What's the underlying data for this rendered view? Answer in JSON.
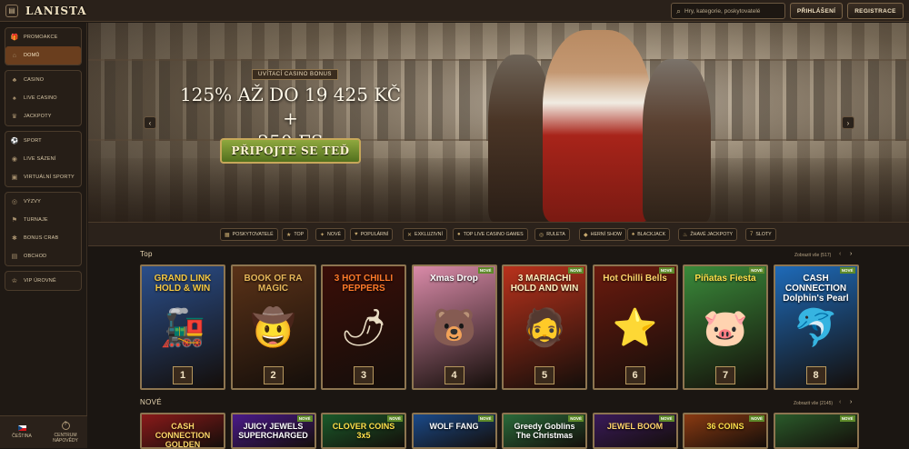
{
  "header": {
    "menu_icon": "menu-icon",
    "logo": "LANISTA",
    "search_placeholder": "Hry, kategorie, poskytovatelé",
    "login_label": "PŘIHLÁŠENÍ",
    "register_label": "REGISTRACE"
  },
  "sidebar": {
    "groups": [
      [
        {
          "label": "PROMOAKCE",
          "icon": "gift-icon"
        },
        {
          "label": "DOMŮ",
          "icon": "home-icon",
          "active": true
        }
      ],
      [
        {
          "label": "CASINO",
          "icon": "cherry-icon"
        },
        {
          "label": "LIVE CASINO",
          "icon": "dealer-icon"
        },
        {
          "label": "JACKPOTY",
          "icon": "trophy-icon"
        }
      ],
      [
        {
          "label": "SPORT",
          "icon": "ball-icon"
        },
        {
          "label": "LIVE SÁZENÍ",
          "icon": "live-icon"
        },
        {
          "label": "VIRTUÁLNÍ SPORTY",
          "icon": "virtual-icon"
        }
      ],
      [
        {
          "label": "VÝZVY",
          "icon": "target-icon"
        },
        {
          "label": "TURNAJE",
          "icon": "tournament-icon"
        },
        {
          "label": "BONUS CRAB",
          "icon": "crab-icon"
        },
        {
          "label": "OBCHOD",
          "icon": "shop-icon"
        }
      ],
      [
        {
          "label": "VIP ÚROVNĚ",
          "icon": "crown-icon"
        }
      ]
    ],
    "footer": {
      "language": "ČEŠTINA",
      "help": "CENTRUM NÁPOVĚDY"
    }
  },
  "hero": {
    "tag": "UVÍTACÍ CASINO BONUS",
    "title_line1": "125% AŽ DO 19 425 KČ +",
    "title_line2": "250 FS",
    "cta": "PŘIPOJTE SE TEĎ",
    "prev": "‹",
    "next": "›"
  },
  "categories": [
    {
      "label": "POSKYTOVATELÉ",
      "icon": "providers-icon"
    },
    {
      "label": "TOP",
      "icon": "top-icon"
    },
    {
      "label": "NOVÉ",
      "icon": "new-icon"
    },
    {
      "label": "POPULÁRNÍ",
      "icon": "popular-icon"
    },
    {
      "label": "EXKLUZIVNÍ",
      "icon": "exclusive-icon"
    },
    {
      "label": "TOP LIVE CASINO GAMES",
      "icon": "live-casino-icon"
    },
    {
      "label": "RULETA",
      "icon": "roulette-icon"
    },
    {
      "label": "HERNÍ SHOW",
      "icon": "game-show-icon"
    },
    {
      "label": "BLACKJACK",
      "icon": "blackjack-icon"
    },
    {
      "label": "ŽHAVÉ JACKPOTY",
      "icon": "hot-jackpot-icon"
    },
    {
      "label": "SLOTY",
      "icon": "slots-icon"
    }
  ],
  "top_section": {
    "title": "Top",
    "show_all": "Zobrazit vše (517)",
    "games": [
      {
        "name": "GRAND LINK HOLD & WIN",
        "rank": "1",
        "bg": "#2a4e8a",
        "color": "#f5c842",
        "glyph": "🚂"
      },
      {
        "name": "BOOK OF RA MAGIC",
        "rank": "2",
        "bg": "#5a3218",
        "color": "#e8b85a",
        "glyph": "🤠"
      },
      {
        "name": "3 HOT CHILLI PEPPERS",
        "rank": "3",
        "bg": "#3a0e08",
        "color": "#ff7a2a",
        "glyph": "🌶"
      },
      {
        "name": "Xmas Drop",
        "rank": "4",
        "bg": "#d98aa8",
        "color": "#ffffff",
        "glyph": "🐻",
        "nove": "NOVÉ"
      },
      {
        "name": "3 MARIACHI HOLD AND WIN",
        "rank": "5",
        "bg": "#b8321c",
        "color": "#fff0c0",
        "glyph": "🧔",
        "nove": "NOVÉ"
      },
      {
        "name": "Hot Chilli Bells",
        "rank": "6",
        "bg": "#6a1a0e",
        "color": "#ffd46a",
        "glyph": "⭐",
        "nove": "NOVÉ"
      },
      {
        "name": "Piñatas Fiesta",
        "rank": "7",
        "bg": "#3a8a3a",
        "color": "#ffe04a",
        "glyph": "🐷",
        "nove": "NOVÉ"
      },
      {
        "name": "CASH CONNECTION Dolphin's Pearl",
        "rank": "8",
        "bg": "#1e6ab8",
        "color": "#ffffff",
        "glyph": "🐬",
        "nove": "NOVÉ"
      }
    ]
  },
  "new_section": {
    "title": "NOVÉ",
    "show_all": "Zobrazit vše (2145)",
    "games": [
      {
        "name": "CASH CONNECTION GOLDEN",
        "bg": "#8a1a1a",
        "color": "#ffd86a"
      },
      {
        "name": "JUICY JEWELS SUPERCHARGED",
        "bg": "#4a1a8a",
        "color": "#ffffff",
        "nove": "NOVÉ"
      },
      {
        "name": "CLOVER COINS 3x5",
        "bg": "#1a5a2a",
        "color": "#ffe04a",
        "nove": "NOVÉ"
      },
      {
        "name": "WOLF FANG",
        "bg": "#1a4a8a",
        "color": "#ffffff",
        "nove": "NOVÉ"
      },
      {
        "name": "Greedy Goblins The Christmas",
        "bg": "#2a6a3a",
        "color": "#ffffff",
        "nove": "NOVÉ"
      },
      {
        "name": "JEWEL BOOM",
        "bg": "#3a1a5a",
        "color": "#ffd46a",
        "nove": "NOVÉ"
      },
      {
        "name": "36 COINS",
        "bg": "#8a3a12",
        "color": "#ffe04a",
        "nove": "NOVÉ"
      },
      {
        "name": "",
        "bg": "#2a5a2a",
        "color": "#ffffff",
        "nove": "NOVÉ"
      }
    ]
  }
}
